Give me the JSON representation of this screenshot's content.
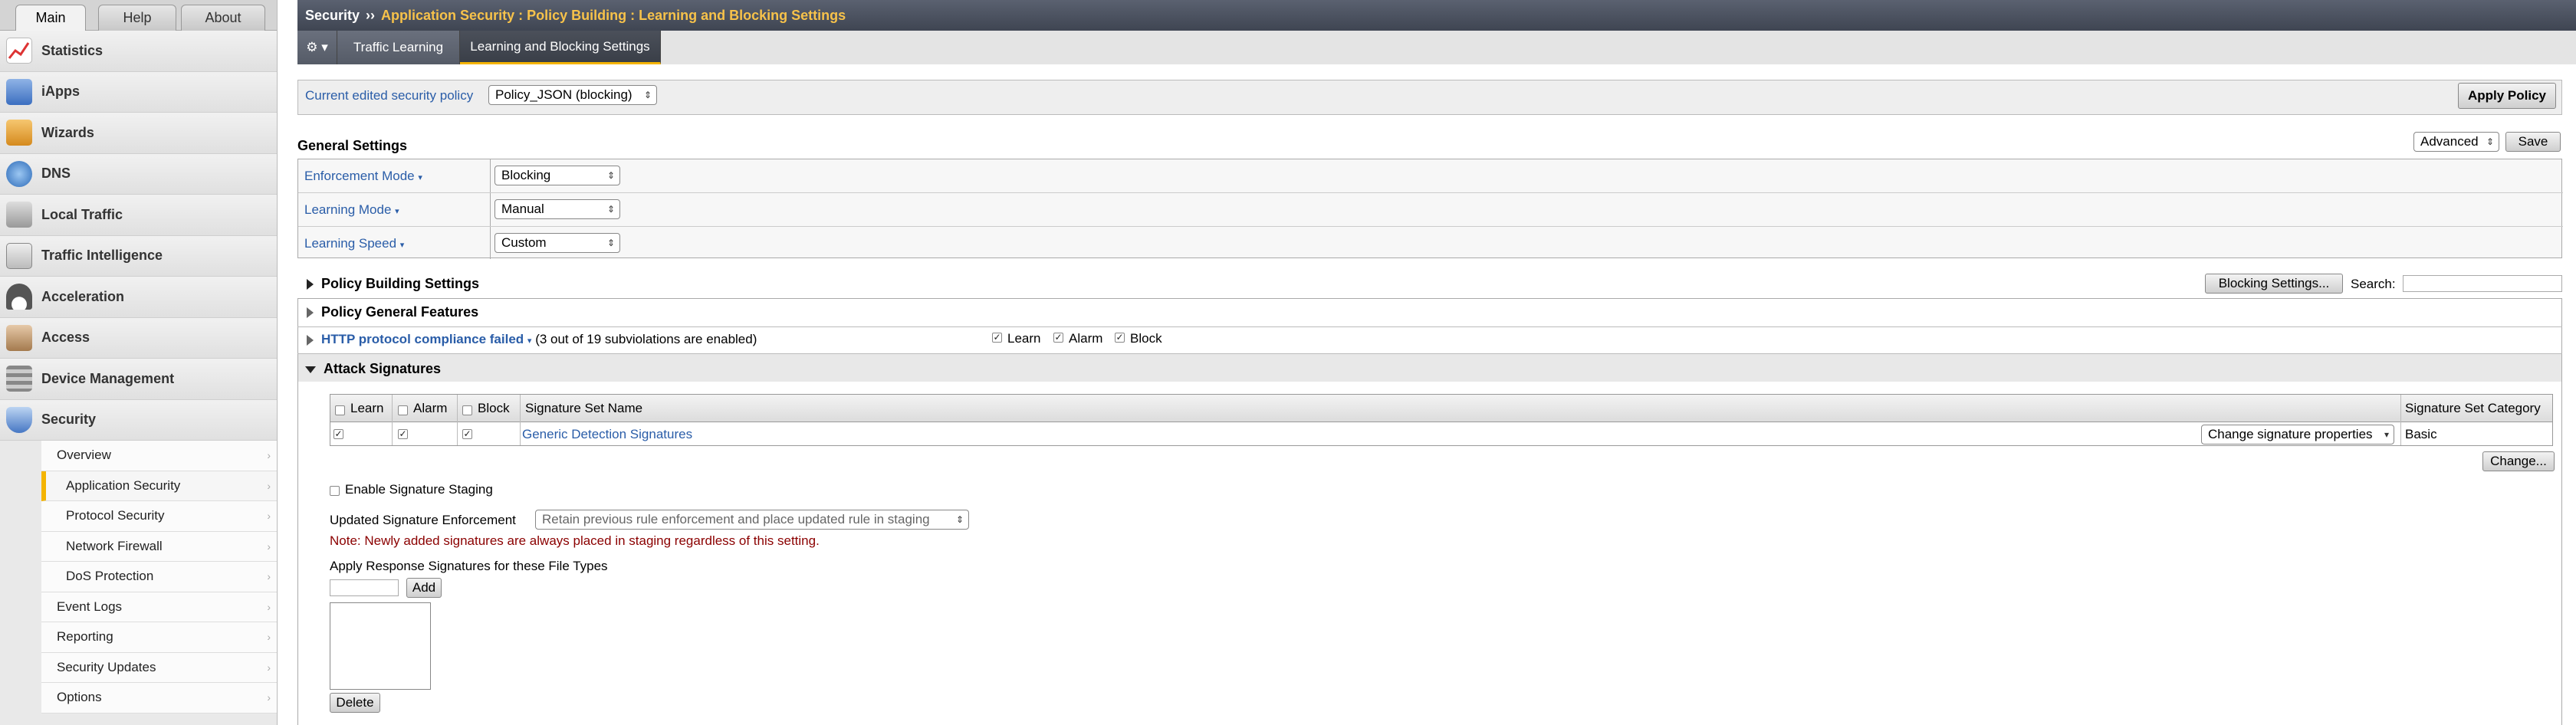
{
  "left_nav": {
    "tabs": [
      "Main",
      "Help",
      "About"
    ],
    "main_items": [
      {
        "label": "Statistics",
        "icon": "statistics-icon"
      },
      {
        "label": "iApps",
        "icon": "iapps-icon"
      },
      {
        "label": "Wizards",
        "icon": "wizards-icon"
      },
      {
        "label": "DNS",
        "icon": "dns-icon"
      },
      {
        "label": "Local Traffic",
        "icon": "local-traffic-icon"
      },
      {
        "label": "Traffic Intelligence",
        "icon": "traffic-intelligence-icon"
      },
      {
        "label": "Acceleration",
        "icon": "acceleration-icon"
      },
      {
        "label": "Access",
        "icon": "access-icon"
      },
      {
        "label": "Device Management",
        "icon": "device-management-icon"
      },
      {
        "label": "Security",
        "icon": "security-shield-icon"
      }
    ],
    "security_sub": [
      "Overview",
      "Application Security",
      "Protocol Security",
      "Network Firewall",
      "DoS Protection",
      "Event Logs",
      "Reporting",
      "Security Updates",
      "Options"
    ]
  },
  "header": {
    "section": "Security",
    "separator": "››",
    "path": "Application Security : Policy Building : Learning and Blocking Settings",
    "gear": "⚙ ▾",
    "tabs": [
      "Traffic Learning",
      "Learning and Blocking Settings"
    ]
  },
  "policy": {
    "label": "Current edited security policy",
    "value": "Policy_JSON (blocking)",
    "apply_button": "Apply Policy"
  },
  "general": {
    "title": "General Settings",
    "mode_select": "Advanced",
    "save_button": "Save",
    "rows": [
      {
        "label": "Enforcement Mode",
        "value": "Blocking"
      },
      {
        "label": "Learning Mode",
        "value": "Manual"
      },
      {
        "label": "Learning Speed",
        "value": "Custom"
      }
    ]
  },
  "policy_building": {
    "title": "Policy Building Settings",
    "blocking_button": "Blocking Settings...",
    "search_label": "Search:",
    "search_value": ""
  },
  "sections": {
    "general_features": "Policy General Features",
    "http_compliance": "HTTP protocol compliance failed",
    "http_note": "(3 out of 19 subviolations are enabled)",
    "learn": "Learn",
    "alarm": "Alarm",
    "block": "Block",
    "attack_signatures": "Attack Signatures"
  },
  "sig_table": {
    "headers": [
      "Learn",
      "Alarm",
      "Block",
      "Signature Set Name",
      "Signature Set Category"
    ],
    "rows": [
      {
        "name": "Generic Detection Signatures",
        "action": "Change signature properties",
        "category": "Basic"
      }
    ],
    "change_button": "Change..."
  },
  "staging": {
    "label": "Enable Signature Staging",
    "updated_label": "Updated Signature Enforcement",
    "updated_value": "Retain previous rule enforcement and place updated rule in staging",
    "note": "Note: Newly added signatures are always placed in staging regardless of this setting."
  },
  "response": {
    "label": "Apply Response Signatures for these File Types",
    "add_button": "Add",
    "delete_button": "Delete"
  },
  "colors": {
    "accent": "#f4b400",
    "link": "#2a5da8",
    "note": "#8b0000",
    "header": "#4a505d"
  }
}
